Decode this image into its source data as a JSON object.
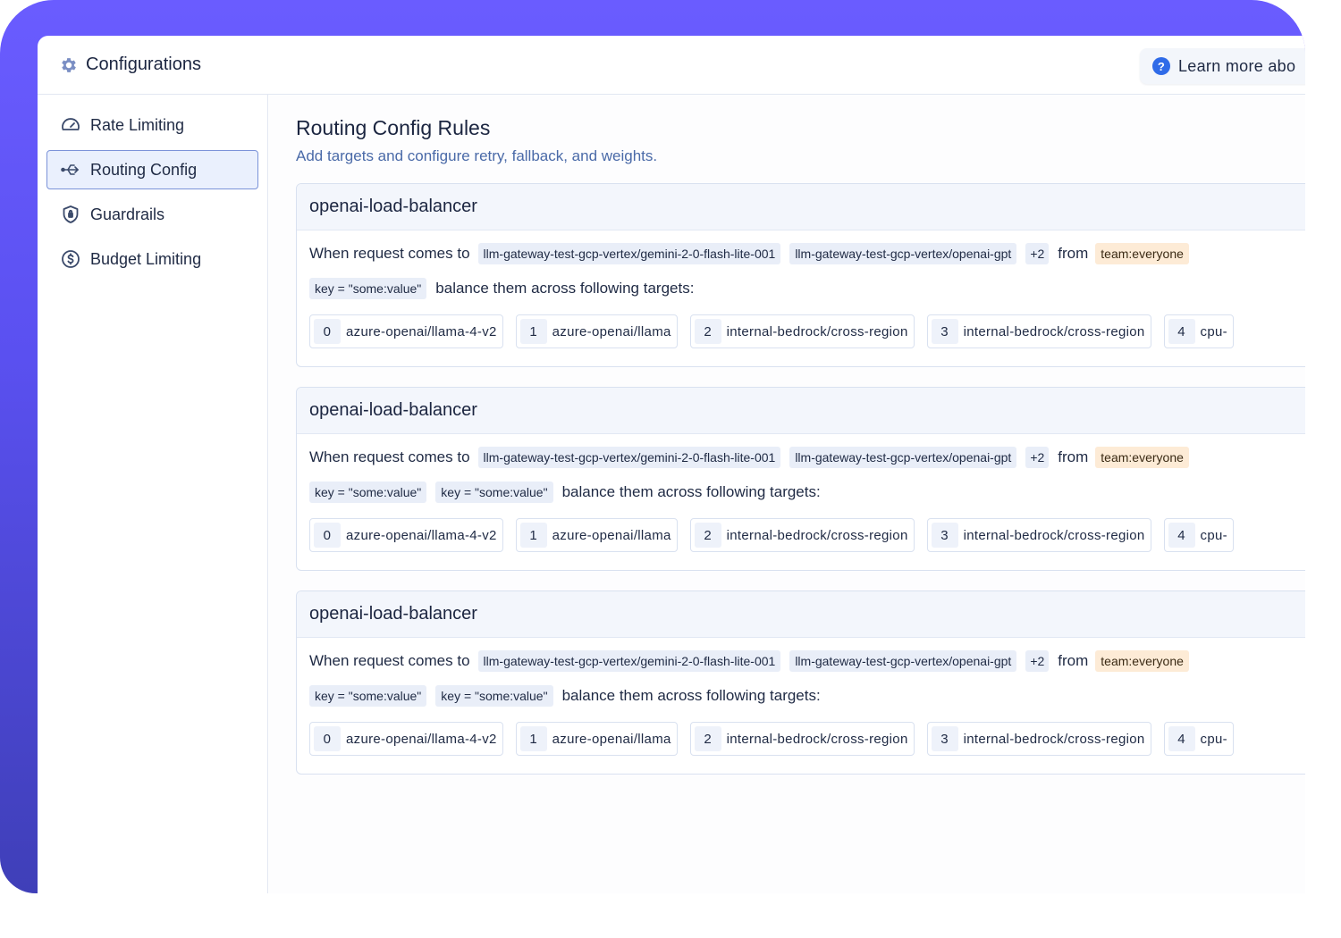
{
  "header": {
    "title": "Configurations",
    "learn_more": "Learn more abo"
  },
  "sidebar": {
    "items": [
      {
        "label": "Rate Limiting",
        "icon": "gauge-icon"
      },
      {
        "label": "Routing Config",
        "icon": "routing-icon",
        "active": true
      },
      {
        "label": "Guardrails",
        "icon": "shield-icon"
      },
      {
        "label": "Budget Limiting",
        "icon": "dollar-icon"
      }
    ]
  },
  "main": {
    "title": "Routing Config Rules",
    "subtitle": "Add targets and configure retry, fallback, and weights."
  },
  "rules": [
    {
      "name": "openai-load-balancer",
      "when": "When request comes to",
      "models": [
        "llm-gateway-test-gcp-vertex/gemini-2-0-flash-lite-001",
        "llm-gateway-test-gcp-vertex/openai-gpt"
      ],
      "more": "+2",
      "from": "from",
      "team": "team:everyone",
      "metadata": [
        "key = \"some:value\""
      ],
      "balance": "balance them across following targets:",
      "targets": [
        {
          "idx": "0",
          "name": "azure-openai/llama-4-v2"
        },
        {
          "idx": "1",
          "name": "azure-openai/llama"
        },
        {
          "idx": "2",
          "name": "internal-bedrock/cross-region"
        },
        {
          "idx": "3",
          "name": "internal-bedrock/cross-region"
        },
        {
          "idx": "4",
          "name": "cpu-"
        }
      ]
    },
    {
      "name": "openai-load-balancer",
      "when": "When request comes to",
      "models": [
        "llm-gateway-test-gcp-vertex/gemini-2-0-flash-lite-001",
        "llm-gateway-test-gcp-vertex/openai-gpt"
      ],
      "more": "+2",
      "from": "from",
      "team": "team:everyone",
      "metadata": [
        "key = \"some:value\"",
        "key = \"some:value\""
      ],
      "balance": "balance them across following targets:",
      "targets": [
        {
          "idx": "0",
          "name": "azure-openai/llama-4-v2"
        },
        {
          "idx": "1",
          "name": "azure-openai/llama"
        },
        {
          "idx": "2",
          "name": "internal-bedrock/cross-region"
        },
        {
          "idx": "3",
          "name": "internal-bedrock/cross-region"
        },
        {
          "idx": "4",
          "name": "cpu-"
        }
      ]
    },
    {
      "name": "openai-load-balancer",
      "when": "When request comes to",
      "models": [
        "llm-gateway-test-gcp-vertex/gemini-2-0-flash-lite-001",
        "llm-gateway-test-gcp-vertex/openai-gpt"
      ],
      "more": "+2",
      "from": "from",
      "team": "team:everyone",
      "metadata": [
        "key = \"some:value\"",
        "key = \"some:value\""
      ],
      "balance": "balance them across following targets:",
      "targets": [
        {
          "idx": "0",
          "name": "azure-openai/llama-4-v2"
        },
        {
          "idx": "1",
          "name": "azure-openai/llama"
        },
        {
          "idx": "2",
          "name": "internal-bedrock/cross-region"
        },
        {
          "idx": "3",
          "name": "internal-bedrock/cross-region"
        },
        {
          "idx": "4",
          "name": "cpu-"
        }
      ]
    }
  ]
}
